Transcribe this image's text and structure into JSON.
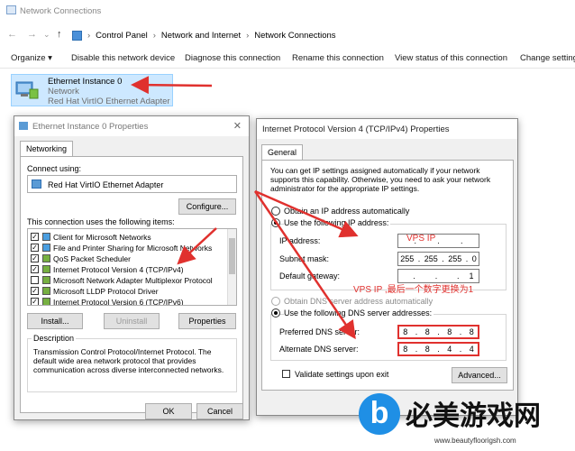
{
  "window": {
    "title": "Network Connections",
    "nav_back": "←",
    "nav_forward": "→",
    "nav_down": "⌄",
    "nav_up": "↑",
    "breadcrumb": [
      "Control Panel",
      "Network and Internet",
      "Network Connections"
    ]
  },
  "toolbar": {
    "organize": "Organize ▾",
    "disable": "Disable this network device",
    "diagnose": "Diagnose this connection",
    "rename": "Rename this connection",
    "view_status": "View status of this connection",
    "change_settings": "Change settings"
  },
  "connection": {
    "name": "Ethernet Instance 0",
    "status": "Network",
    "adapter": "Red Hat VirtIO Ethernet Adapter"
  },
  "props_dialog": {
    "title": "Ethernet Instance 0 Properties",
    "tab": "Networking",
    "connect_using_label": "Connect using:",
    "adapter_name": "Red Hat VirtIO Ethernet Adapter",
    "configure": "Configure...",
    "items_label": "This connection uses the following items:",
    "items": [
      {
        "label": "Client for Microsoft Networks",
        "checked": true
      },
      {
        "label": "File and Printer Sharing for Microsoft Networks",
        "checked": true
      },
      {
        "label": "QoS Packet Scheduler",
        "checked": true
      },
      {
        "label": "Internet Protocol Version 4 (TCP/IPv4)",
        "checked": true
      },
      {
        "label": "Microsoft Network Adapter Multiplexor Protocol",
        "checked": false
      },
      {
        "label": "Microsoft LLDP Protocol Driver",
        "checked": true
      },
      {
        "label": "Internet Protocol Version 6 (TCP/IPv6)",
        "checked": true
      }
    ],
    "install": "Install...",
    "uninstall": "Uninstall",
    "properties": "Properties",
    "description_label": "Description",
    "description": "Transmission Control Protocol/Internet Protocol. The default wide area network protocol that provides communication across diverse interconnected networks.",
    "ok": "OK",
    "cancel": "Cancel"
  },
  "ipv4_dialog": {
    "title": "Internet Protocol Version 4 (TCP/IPv4) Properties",
    "tab": "General",
    "intro": "You can get IP settings assigned automatically if your network supports this capability. Otherwise, you need to ask your network administrator for the appropriate IP settings.",
    "obtain_auto": "Obtain an IP address automatically",
    "use_following": "Use the following IP address:",
    "ip_label": "IP address:",
    "ip_value": [
      "",
      "",
      "",
      ""
    ],
    "ip_annotation": "VPS IP",
    "subnet_label": "Subnet mask:",
    "subnet_value": [
      "255",
      "255",
      "255",
      "0"
    ],
    "gateway_label": "Default gateway:",
    "gateway_value": [
      "",
      "",
      "",
      "1"
    ],
    "gateway_annotation": "VPS IP ,最后一个数字更换为1",
    "dns_auto": "Obtain DNS server address automatically",
    "dns_following": "Use the following DNS server addresses:",
    "preferred_dns_label": "Preferred DNS server:",
    "preferred_dns": [
      "8",
      "8",
      "8",
      "8"
    ],
    "alternate_dns_label": "Alternate DNS server:",
    "alternate_dns": [
      "8",
      "8",
      "4",
      "4"
    ],
    "validate": "Validate settings upon exit",
    "advanced": "Advanced..."
  },
  "watermark": {
    "logo_letter": "b",
    "text": "必美游戏网",
    "url": "www.beautyfloorigsh.com"
  },
  "colors": {
    "accent_red": "#e0312e",
    "selection": "#cde8ff",
    "watermark_blue": "#1f8fe5"
  }
}
